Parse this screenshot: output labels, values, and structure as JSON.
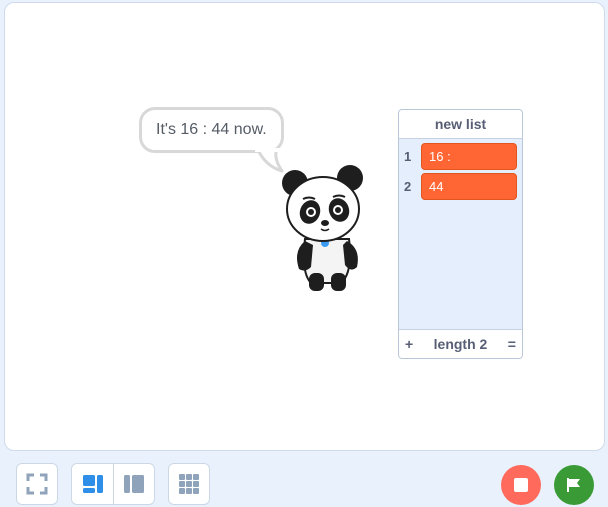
{
  "stage": {
    "speech_bubble": "It's 16 : 44 now.",
    "sprite": "panda-sprite"
  },
  "list_monitor": {
    "title": "new list",
    "items": [
      {
        "index": "1",
        "value": "16 :"
      },
      {
        "index": "2",
        "value": "44"
      }
    ],
    "add_label": "+",
    "length_label": "length 2",
    "resize_label": "="
  },
  "controls": {
    "fullscreen": "fullscreen-icon",
    "small_stage": "small-stage-icon",
    "large_stage": "large-stage-icon",
    "grid": "grid-icon",
    "stop": "stop-icon",
    "go": "green-flag-icon"
  },
  "colors": {
    "list_item": "#ff6633",
    "stop": "#ff6a5d",
    "go": "#3a9b36",
    "accent": "#3b9bf2"
  }
}
